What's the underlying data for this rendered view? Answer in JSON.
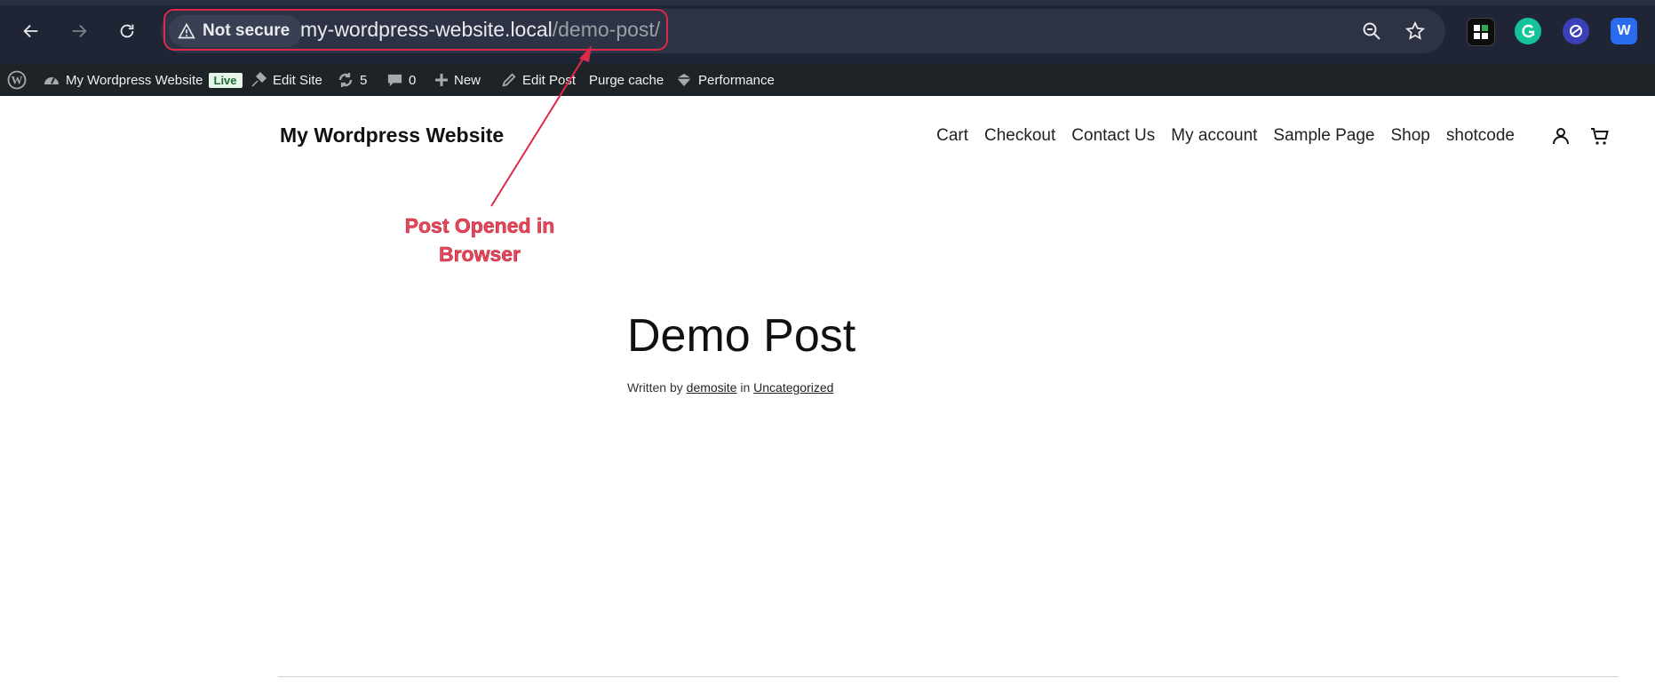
{
  "browser": {
    "security_label": "Not secure",
    "url_host": "my-wordpress-website.local",
    "url_path": "/demo-post/",
    "extensions": [
      "grid-extension-icon",
      "grammarly-icon",
      "sync-extension-icon",
      "w-extension-icon"
    ]
  },
  "adminbar": {
    "site_name": "My Wordpress Website",
    "live_badge": "Live",
    "edit_site": "Edit Site",
    "updates_count": "5",
    "comments_count": "0",
    "new_label": "New",
    "edit_post": "Edit Post",
    "purge_cache": "Purge cache",
    "performance": "Performance"
  },
  "site": {
    "title": "My Wordpress Website",
    "nav": [
      "Cart",
      "Checkout",
      "Contact Us",
      "My account",
      "Sample Page",
      "Shop",
      "shotcode"
    ]
  },
  "annotation": {
    "line1": "Post Opened in",
    "line2": "Browser",
    "color": "#e0284a"
  },
  "post": {
    "title": "Demo Post",
    "meta_prefix": "Written by",
    "author": "demosite",
    "meta_in": "in",
    "category": "Uncategorized"
  },
  "colors": {
    "chrome_bg": "#1f2535",
    "adminbar_bg": "#1d2327"
  }
}
